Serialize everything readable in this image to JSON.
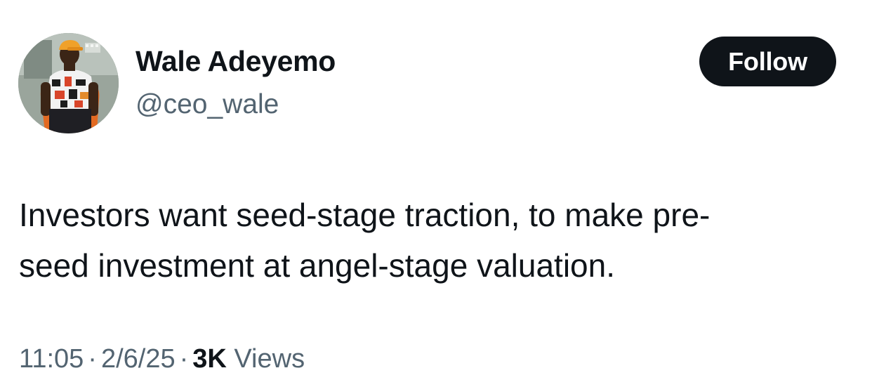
{
  "author": {
    "display_name": "Wale Adeyemo",
    "handle": "@ceo_wale"
  },
  "follow_button": {
    "label": "Follow"
  },
  "tweet": {
    "text_lines": [
      "Investors want seed-stage traction, to make pre-",
      "seed investment at angel-stage valuation."
    ]
  },
  "meta": {
    "time": "11:05",
    "date": "2/6/25",
    "views_count": "3K",
    "views_label": "Views",
    "separator": "·"
  },
  "colors": {
    "text_primary": "#0f1419",
    "text_secondary": "#536471",
    "button_bg": "#0f1419",
    "button_text": "#ffffff"
  },
  "icons": {
    "avatar": "profile-photo"
  }
}
